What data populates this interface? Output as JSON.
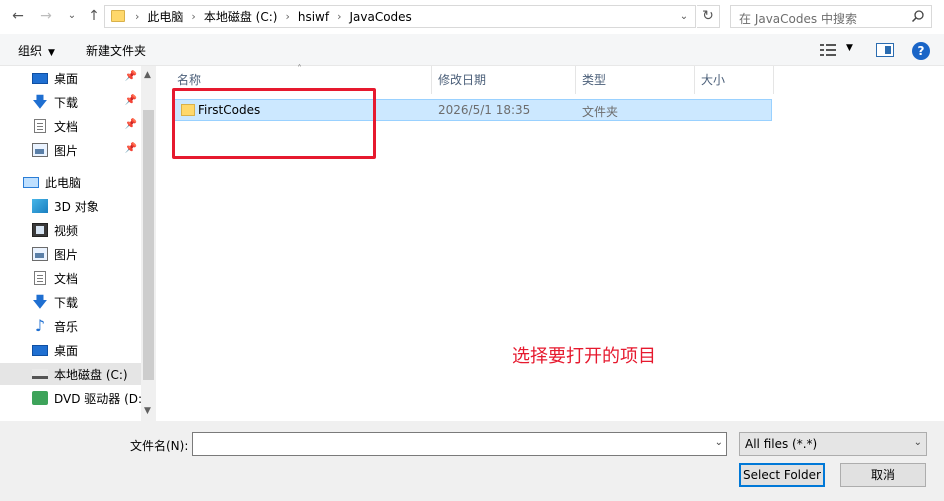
{
  "address": {
    "crumbs": [
      "此电脑",
      "本地磁盘 (C:)",
      "hsiwf",
      "JavaCodes"
    ],
    "search_placeholder": "在 JavaCodes 中搜索"
  },
  "toolbar": {
    "organize_label": "组织",
    "new_folder_label": "新建文件夹"
  },
  "nav": {
    "items": [
      {
        "label": "桌面",
        "icon": "desktop-icon",
        "pinned": true
      },
      {
        "label": "下载",
        "icon": "download-icon",
        "pinned": true
      },
      {
        "label": "文档",
        "icon": "document-icon",
        "pinned": true
      },
      {
        "label": "图片",
        "icon": "picture-icon",
        "pinned": true
      },
      {
        "label": "此电脑",
        "icon": "this-pc-icon"
      },
      {
        "label": "3D 对象",
        "icon": "3d-objects-icon"
      },
      {
        "label": "视频",
        "icon": "video-icon"
      },
      {
        "label": "图片",
        "icon": "picture-icon"
      },
      {
        "label": "文档",
        "icon": "document-icon"
      },
      {
        "label": "下载",
        "icon": "download-icon"
      },
      {
        "label": "音乐",
        "icon": "music-icon"
      },
      {
        "label": "桌面",
        "icon": "desktop-icon"
      },
      {
        "label": "本地磁盘 (C:)",
        "icon": "drive-icon",
        "selected": true
      },
      {
        "label": "DVD 驱动器 (D:",
        "icon": "dvd-drive-icon"
      }
    ]
  },
  "columns": {
    "name": "名称",
    "date": "修改日期",
    "type": "类型",
    "size": "大小"
  },
  "files": [
    {
      "name": "FirstCodes",
      "date": "2026/5/1 18:35",
      "type": "文件夹",
      "size": ""
    }
  ],
  "annotation": {
    "text": "选择要打开的项目",
    "color": "#e6192e"
  },
  "bottom": {
    "filename_label": "文件名(N):",
    "filename_value": "",
    "filetype_value": "All files (*.*)",
    "select_button": "Select Folder",
    "cancel_button": "取消"
  }
}
